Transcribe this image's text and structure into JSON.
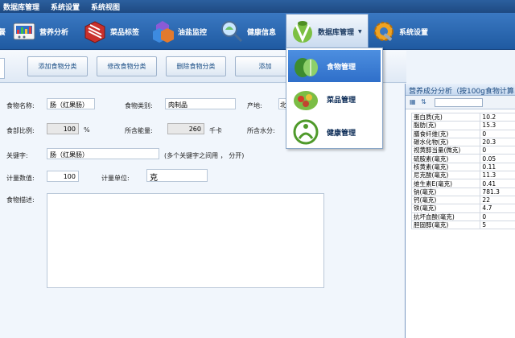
{
  "menubar": {
    "items": [
      "数据库管理",
      "系统设置",
      "系统视图"
    ]
  },
  "ribbon": {
    "items": [
      {
        "label": "餐",
        "icon": "meal-icon"
      },
      {
        "label": "营养分析",
        "icon": "nutrition-analysis-icon"
      },
      {
        "label": "菜品标签",
        "icon": "dish-label-icon"
      },
      {
        "label": "油盐监控",
        "icon": "oil-salt-monitor-icon"
      },
      {
        "label": "健康信息",
        "icon": "health-info-icon"
      },
      {
        "label": "数据库管理",
        "icon": "database-manage-icon",
        "active": true
      },
      {
        "label": "系统设置",
        "icon": "gear-icon"
      }
    ]
  },
  "dropdown": {
    "items": [
      {
        "label": "食物管理",
        "icon": "vegetable-icon",
        "selected": true
      },
      {
        "label": "菜品管理",
        "icon": "dish-icon"
      },
      {
        "label": "健康管理",
        "icon": "health-manage-icon"
      }
    ]
  },
  "toolbar": {
    "buttons": [
      "添加食物分类",
      "修改食物分类",
      "删除食物分类",
      "添加"
    ]
  },
  "form": {
    "food_name_label": "食物名称:",
    "food_name": "肠（红果肠）",
    "food_category_label": "食物类别:",
    "food_category": "肉制品",
    "origin_label": "产地:",
    "origin": "北",
    "edible_ratio_label": "食部比例:",
    "edible_ratio": "100",
    "edible_ratio_unit": "%",
    "energy_label": "所含能量:",
    "energy": "260",
    "energy_unit": "千卡",
    "water_label": "所含水分:",
    "keyword_label": "关键字:",
    "keyword": "肠（红果肠）",
    "keyword_hint": "(多个关键字之间用 ， 分开)",
    "measure_value_label": "计量数值:",
    "measure_value": "100",
    "measure_unit_label": "计量单位:",
    "measure_unit": "克",
    "description_label": "食物描述:"
  },
  "nutrition": {
    "title": "营养成分分析（按100g食物计算",
    "rows": [
      {
        "name": "蛋白质(克)",
        "value": "10.2"
      },
      {
        "name": "脂肪(克)",
        "value": "15.3"
      },
      {
        "name": "膳食纤维(克)",
        "value": "0"
      },
      {
        "name": "碳水化物(克)",
        "value": "20.3"
      },
      {
        "name": "视黄醇当量(微克)",
        "value": "0"
      },
      {
        "name": "硫胺素(毫克)",
        "value": "0.05"
      },
      {
        "name": "核黄素(毫克)",
        "value": "0.11"
      },
      {
        "name": "尼克酸(毫克)",
        "value": "11.3"
      },
      {
        "name": "维生素E(毫克)",
        "value": "0.41"
      },
      {
        "name": "钠(毫克)",
        "value": "781.3"
      },
      {
        "name": "钙(毫克)",
        "value": "22"
      },
      {
        "name": "铁(毫克)",
        "value": "4.7"
      },
      {
        "name": "抗坏血酸(毫克)",
        "value": "0"
      },
      {
        "name": "胆固醇(毫克)",
        "value": "5"
      }
    ]
  }
}
